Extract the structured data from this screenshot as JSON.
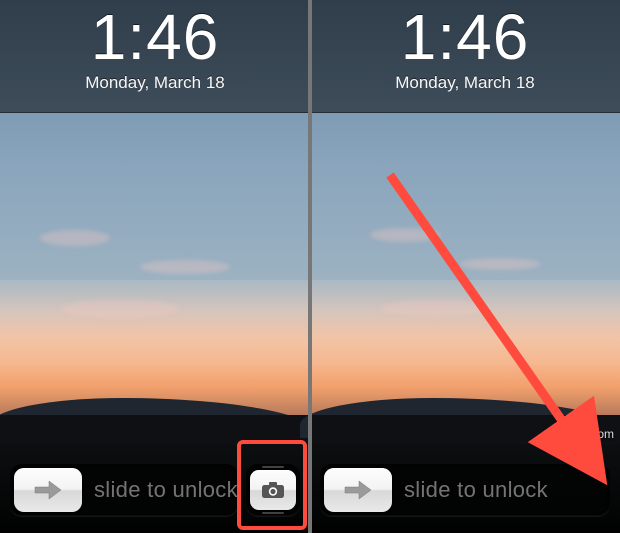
{
  "left": {
    "time": "1:46",
    "date": "Monday, March 18",
    "slide_label": "slide to unlock",
    "has_camera_button": true
  },
  "right": {
    "time": "1:46",
    "date": "Monday, March 18",
    "slide_label": "slide to unlock",
    "has_camera_button": false
  },
  "watermark": "osxdaily.com",
  "annotation": {
    "highlight_target": "camera-button",
    "arrow_points_to": "bottom-bar-right-edge",
    "arrow_color": "#ff4b3e"
  },
  "icons": {
    "arrow": "arrow-right-icon",
    "camera": "camera-icon"
  }
}
